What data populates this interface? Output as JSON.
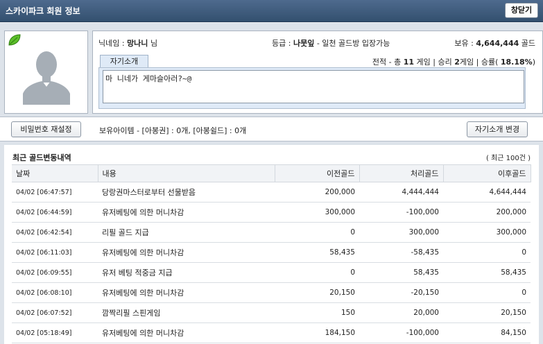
{
  "window": {
    "title": "스카이파크 회원 정보",
    "close_label": "창닫기"
  },
  "profile": {
    "nick_label": "닉네임 :",
    "nick_value": "망나니",
    "nick_suffix": "님",
    "grade_label": "등급 :",
    "grade_value": "나뭇잎",
    "grade_desc": "- 일천 골드방 입장가능",
    "holding_label": "보유 :",
    "holding_value": "4,644,444",
    "holding_unit": "골드",
    "record": {
      "prefix": "전적 - 총",
      "total": "11",
      "total_unit": "게임 | 승리",
      "wins": "2",
      "wins_unit": "게임 | 승률(",
      "rate": "18.18%",
      "rate_close": ")"
    },
    "intro_tab": "자기소개",
    "intro_text": "마 니네가 게마슬아러?~@"
  },
  "actions": {
    "password_reset": "비밀번호 재설정",
    "items_text": "보유아이템 - [아봉권] : 0개, [아봉쉴드] : 0개",
    "edit_intro": "자기소개 변경"
  },
  "history": {
    "title": "최근 골드변동내역",
    "count_note": "( 최근 100건 )",
    "columns": [
      "날짜",
      "내용",
      "이전골드",
      "처리골드",
      "이후골드"
    ],
    "rows": [
      [
        "04/02 [06:47:57]",
        "당랑권마스터로부터 선물받음",
        "200,000",
        "4,444,444",
        "4,644,444"
      ],
      [
        "04/02 [06:44:59]",
        "유저베팅에 의한 머니차감",
        "300,000",
        "-100,000",
        "200,000"
      ],
      [
        "04/02 [06:42:54]",
        "리필 골드 지급",
        "0",
        "300,000",
        "300,000"
      ],
      [
        "04/02 [06:11:03]",
        "유저베팅에 의한 머니차감",
        "58,435",
        "-58,435",
        "0"
      ],
      [
        "04/02 [06:09:55]",
        "유저 베팅 적중금 지급",
        "0",
        "58,435",
        "58,435"
      ],
      [
        "04/02 [06:08:10]",
        "유저베팅에 의한 머니차감",
        "20,150",
        "-20,150",
        "0"
      ],
      [
        "04/02 [06:07:52]",
        "깜짝리필 스핀게임",
        "150",
        "20,000",
        "20,150"
      ],
      [
        "04/02 [05:18:49]",
        "유저베팅에 의한 머니차감",
        "184,150",
        "-100,000",
        "84,150"
      ]
    ]
  },
  "colors": {
    "titlebar": "#3d5a7d",
    "panel": "#dde3ea",
    "intro_bg": "#dfeaf7"
  }
}
